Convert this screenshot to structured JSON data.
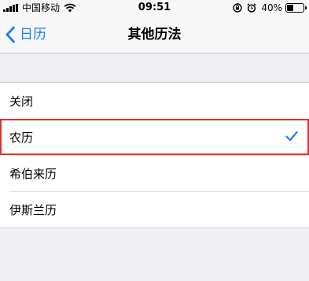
{
  "status_bar": {
    "carrier": "中国移动",
    "time": "09:51",
    "battery_percent": "40%",
    "battery_level": 0.4,
    "icons": [
      "signal-icon",
      "wifi-icon",
      "rotation-lock-icon",
      "alarm-icon",
      "battery-icon"
    ]
  },
  "nav": {
    "back_label": "日历",
    "title": "其他历法"
  },
  "calendar_options": {
    "items": [
      {
        "label": "关闭",
        "selected": false
      },
      {
        "label": "农历",
        "selected": true
      },
      {
        "label": "希伯来历",
        "selected": false
      },
      {
        "label": "伊斯兰历",
        "selected": false
      }
    ]
  },
  "colors": {
    "accent": "#157efb",
    "highlight_border": "#e0322d",
    "background": "#efeff4"
  }
}
